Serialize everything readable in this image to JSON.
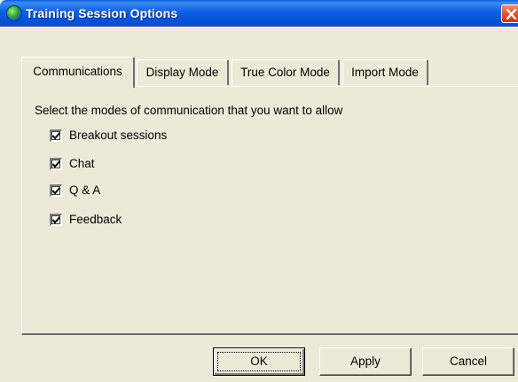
{
  "window": {
    "title": "Training Session Options",
    "accent": "#0a5fe0",
    "close_color": "#e24d22"
  },
  "tabs": [
    {
      "label": "Communications",
      "active": true
    },
    {
      "label": "Display Mode",
      "active": false
    },
    {
      "label": "True Color Mode",
      "active": false
    },
    {
      "label": "Import Mode",
      "active": false
    }
  ],
  "communications": {
    "instruction": "Select the modes of communication that you want to allow",
    "options": [
      {
        "label": "Breakout sessions",
        "checked": true
      },
      {
        "label": "Chat",
        "checked": true
      },
      {
        "label": "Q & A",
        "checked": true
      },
      {
        "label": "Feedback",
        "checked": true
      }
    ]
  },
  "buttons": {
    "ok": "OK",
    "apply": "Apply",
    "cancel": "Cancel"
  },
  "icons": {
    "app": "globe-icon",
    "close": "close-icon",
    "check": "checkmark-icon"
  }
}
